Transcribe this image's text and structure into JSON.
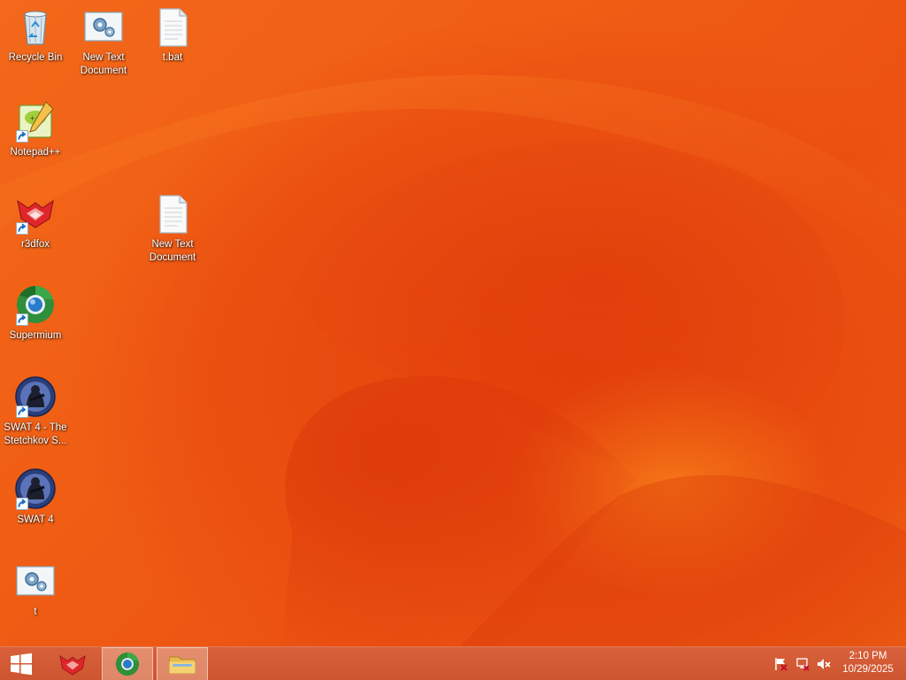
{
  "desktop": {
    "icons": [
      {
        "label": "Recycle Bin",
        "icon": "recycle-bin-icon"
      },
      {
        "label": "New Text Document",
        "icon": "settings-file-icon"
      },
      {
        "label": "t.bat",
        "icon": "text-file-icon"
      },
      {
        "label": "Notepad++",
        "icon": "notepad-plus-plus-icon"
      },
      {
        "label": "r3dfox",
        "icon": "r3dfox-icon"
      },
      {
        "label": "New Text Document",
        "icon": "text-file-icon"
      },
      {
        "label": "Supermium",
        "icon": "supermium-icon"
      },
      {
        "label": "SWAT 4 - The Stetchkov S...",
        "icon": "swat4-icon"
      },
      {
        "label": "SWAT 4",
        "icon": "swat4-icon"
      },
      {
        "label": "t",
        "icon": "settings-file-icon"
      }
    ]
  },
  "taskbar": {
    "start": "windows-logo-icon",
    "apps": [
      "r3dfox-icon",
      "supermium-icon",
      "file-explorer-icon"
    ],
    "tray": [
      "action-center-flag-icon",
      "network-icon",
      "volume-muted-icon"
    ],
    "clock": {
      "time": "2:10 PM",
      "date": "10/29/2025"
    }
  },
  "colors": {
    "wallpaper": "#ee5a12",
    "taskbar": "#d05a33"
  }
}
